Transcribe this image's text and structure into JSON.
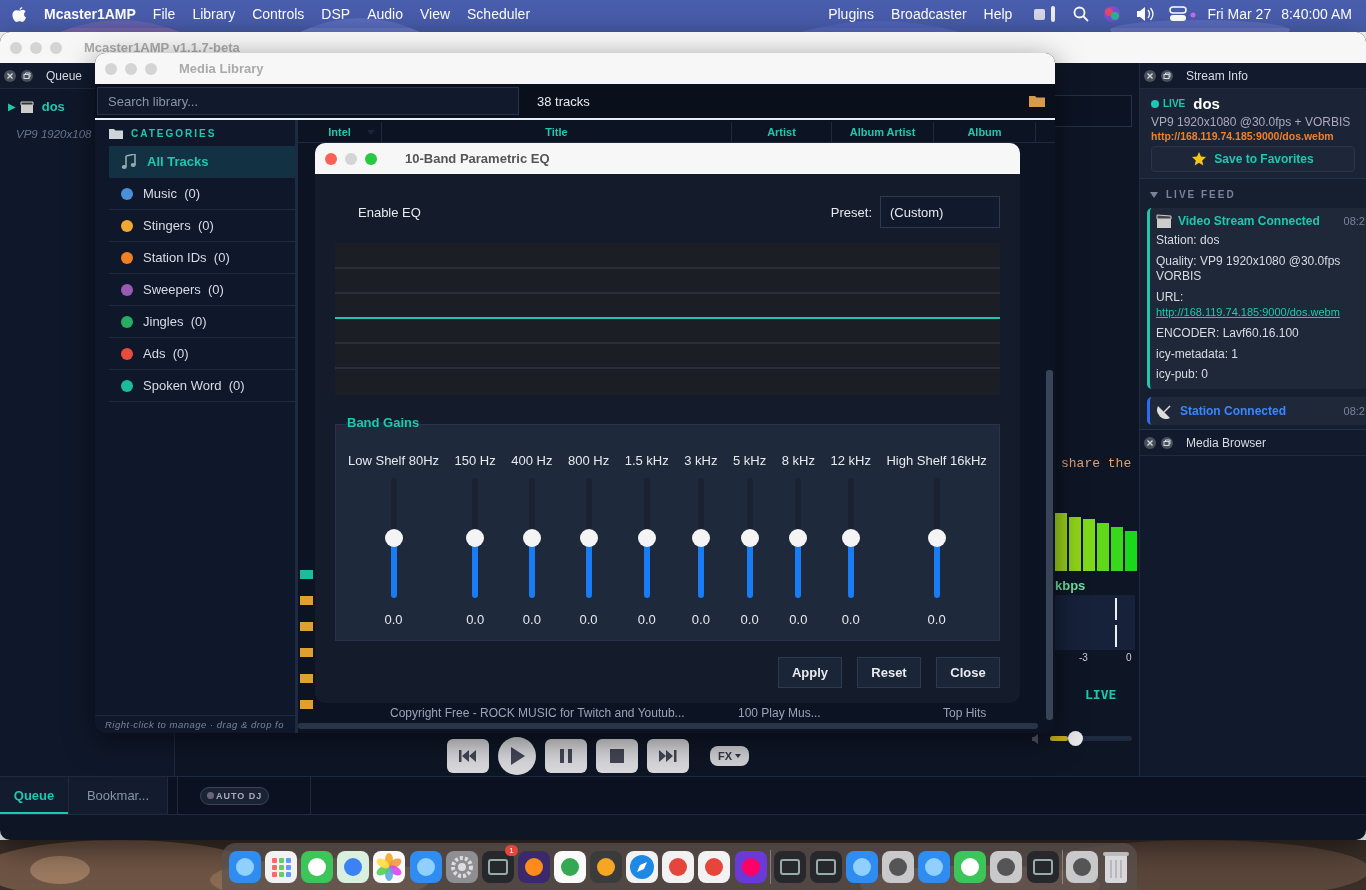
{
  "menubar": {
    "app_name": "Mcaster1AMP",
    "menus_left": [
      "File",
      "Library",
      "Controls",
      "DSP",
      "Audio",
      "View",
      "Scheduler"
    ],
    "menus_right": [
      "Plugins",
      "Broadcaster",
      "Help"
    ],
    "date": "Fri Mar 27",
    "time": "8:40:00 AM"
  },
  "main_window": {
    "title": "Mcaster1AMP v1.1.7-beta",
    "active": false,
    "queue": {
      "title": "Queue",
      "items": [
        {
          "icon": "▶",
          "name": "dos",
          "detail": "VP9 1920x108"
        }
      ]
    },
    "bottom_tabs": [
      {
        "label": "Queue",
        "selected": true
      },
      {
        "label": "Bookmar...",
        "selected": false
      }
    ],
    "auto_dj": {
      "label": "AUTO DJ",
      "on": false
    },
    "player": {
      "scroll_text": "share the",
      "bitrate_unit": "kbps",
      "meter_ticks": [
        "-3",
        "0"
      ],
      "live": "LIVE",
      "fx": "FX",
      "volume": {
        "level": 0.27
      }
    },
    "stream_info": {
      "title": "Stream Info",
      "status": "LIVE",
      "station": "dos",
      "format": "VP9 1920x1080 @30.0fps + VORBIS",
      "url": "http://168.119.74.185:9000/dos.webm",
      "favorite_button": "Save to Favorites",
      "feed_title": "LIVE FEED",
      "feed_expanded": true,
      "feed": [
        {
          "kind": "video",
          "title": "Video Stream Connected",
          "time": "08:2",
          "lines": [
            {
              "text": "Station: dos"
            },
            {
              "text": "Quality: VP9 1920x1080 @30.0fps VORBIS"
            },
            {
              "text": "URL:",
              "link": "http://168.119.74.185:9000/dos.webm"
            },
            {
              "text": "ENCODER: Lavf60.16.100"
            },
            {
              "text": "icy-metadata: 1"
            },
            {
              "text": "icy-pub: 0"
            }
          ]
        },
        {
          "kind": "station",
          "title": "Station Connected",
          "time": "08:2"
        }
      ]
    },
    "media_browser": {
      "title": "Media Browser"
    }
  },
  "library_window": {
    "title": "Media Library",
    "active": false,
    "search_placeholder": "Search library...",
    "track_count": "38 tracks",
    "categories_title": "CATEGORIES",
    "categories": [
      {
        "label": "All Tracks",
        "selected": true
      },
      {
        "label": "Music",
        "count": "(0)",
        "color": "#4a90d9",
        "selected": false
      },
      {
        "label": "Stingers",
        "count": "(0)",
        "color": "#f0a830",
        "selected": false
      },
      {
        "label": "Station IDs",
        "count": "(0)",
        "color": "#f08020",
        "selected": false
      },
      {
        "label": "Sweepers",
        "count": "(0)",
        "color": "#9b59b6",
        "selected": false
      },
      {
        "label": "Jingles",
        "count": "(0)",
        "color": "#27ae60",
        "selected": false
      },
      {
        "label": "Ads",
        "count": "(0)",
        "color": "#e74c3c",
        "selected": false
      },
      {
        "label": "Spoken Word",
        "count": "(0)",
        "color": "#1abc9c",
        "selected": false
      }
    ],
    "columns": [
      "Intel",
      "Title",
      "Artist",
      "Album Artist",
      "Album"
    ],
    "row_markers": [
      {
        "color": "#1abc9c"
      },
      {
        "color": "#e0a030"
      },
      {
        "color": "#e0a030"
      },
      {
        "color": "#e0a030"
      },
      {
        "color": "#e0a030"
      },
      {
        "color": "#e0a030"
      }
    ],
    "visible_row": [
      "Copyright Free - ROCK MUSIC for Twitch and Youtub...",
      "100 Play Mus...",
      "Top Hits"
    ],
    "footer": "Right-click to manage  ·  drag & drop fo"
  },
  "eq_window": {
    "title": "10-Band Parametric EQ",
    "active": true,
    "enable_label": "Enable EQ",
    "preset_label": "Preset:",
    "preset": "(Custom)",
    "group_title": "Band Gains",
    "bands": [
      {
        "label": "Low Shelf 80Hz",
        "value": "0.0",
        "level": 0.5
      },
      {
        "label": "150 Hz",
        "value": "0.0",
        "level": 0.5
      },
      {
        "label": "400 Hz",
        "value": "0.0",
        "level": 0.5
      },
      {
        "label": "800 Hz",
        "value": "0.0",
        "level": 0.5
      },
      {
        "label": "1.5 kHz",
        "value": "0.0",
        "level": 0.5
      },
      {
        "label": "3 kHz",
        "value": "0.0",
        "level": 0.5
      },
      {
        "label": "5 kHz",
        "value": "0.0",
        "level": 0.5
      },
      {
        "label": "8 kHz",
        "value": "0.0",
        "level": 0.5
      },
      {
        "label": "12 kHz",
        "value": "0.0",
        "level": 0.5
      },
      {
        "label": "High Shelf 16kHz",
        "value": "0.0",
        "level": 0.5
      }
    ],
    "buttons": [
      "Apply",
      "Reset",
      "Close"
    ]
  },
  "dock": {
    "items": [
      {
        "kind": "blue"
      },
      {
        "kind": "grid"
      },
      {
        "kind": "green"
      },
      {
        "kind": "map"
      },
      {
        "kind": "flower"
      },
      {
        "kind": "blue"
      },
      {
        "kind": "gear"
      },
      {
        "kind": "dark",
        "badge": "1"
      },
      {
        "kind": "orange"
      },
      {
        "kind": "circle"
      },
      {
        "kind": "amber"
      },
      {
        "kind": "compass"
      },
      {
        "kind": "red"
      },
      {
        "kind": "red"
      },
      {
        "kind": "cube"
      },
      {
        "kind": "separator"
      },
      {
        "kind": "dark"
      },
      {
        "kind": "dark"
      },
      {
        "kind": "blue"
      },
      {
        "kind": "grey"
      },
      {
        "kind": "blue"
      },
      {
        "kind": "green"
      },
      {
        "kind": "grey"
      },
      {
        "kind": "dark"
      },
      {
        "kind": "separator"
      },
      {
        "kind": "grey"
      },
      {
        "kind": "trash"
      }
    ]
  }
}
